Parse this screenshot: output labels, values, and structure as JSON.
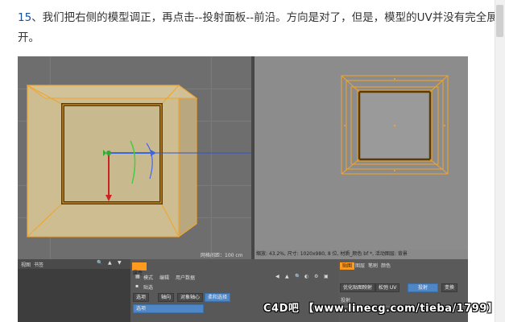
{
  "step": {
    "number": "15",
    "text": "、我们把右侧的模型调正，再点击--投射面板--前沿。方向是对了，但是，模型的UV并没有完全展开。"
  },
  "viewport_left": {
    "grid_label": "网格间距：100 cm",
    "bottom_menu": [
      "视图",
      "书签"
    ]
  },
  "viewport_right": {
    "status": "缩放: 43.2%, 尺寸: 1020x980, 8 位, 材质_颜色 bf *, 活动图层: 背景"
  },
  "attributes_panel": {
    "title": "属性",
    "menu": [
      "模式",
      "编辑",
      "用户数据"
    ],
    "subtitle": "贴选",
    "tabs": [
      "选项",
      "轴向",
      "对象轴心",
      "柔和选择"
    ],
    "active_tab": "柔和选择",
    "row_label": "选项"
  },
  "uv_panel": {
    "tabs": [
      "贴图",
      "图层",
      "笔刷",
      "颜色"
    ],
    "active_tab": "贴图",
    "buttons": [
      "优化贴图映射",
      "松弛 UV",
      "投射",
      "变换"
    ],
    "active_button": "投射",
    "section_label": "投射"
  },
  "watermark": "C4D吧 【www.linecg.com/tieba/1799】"
}
